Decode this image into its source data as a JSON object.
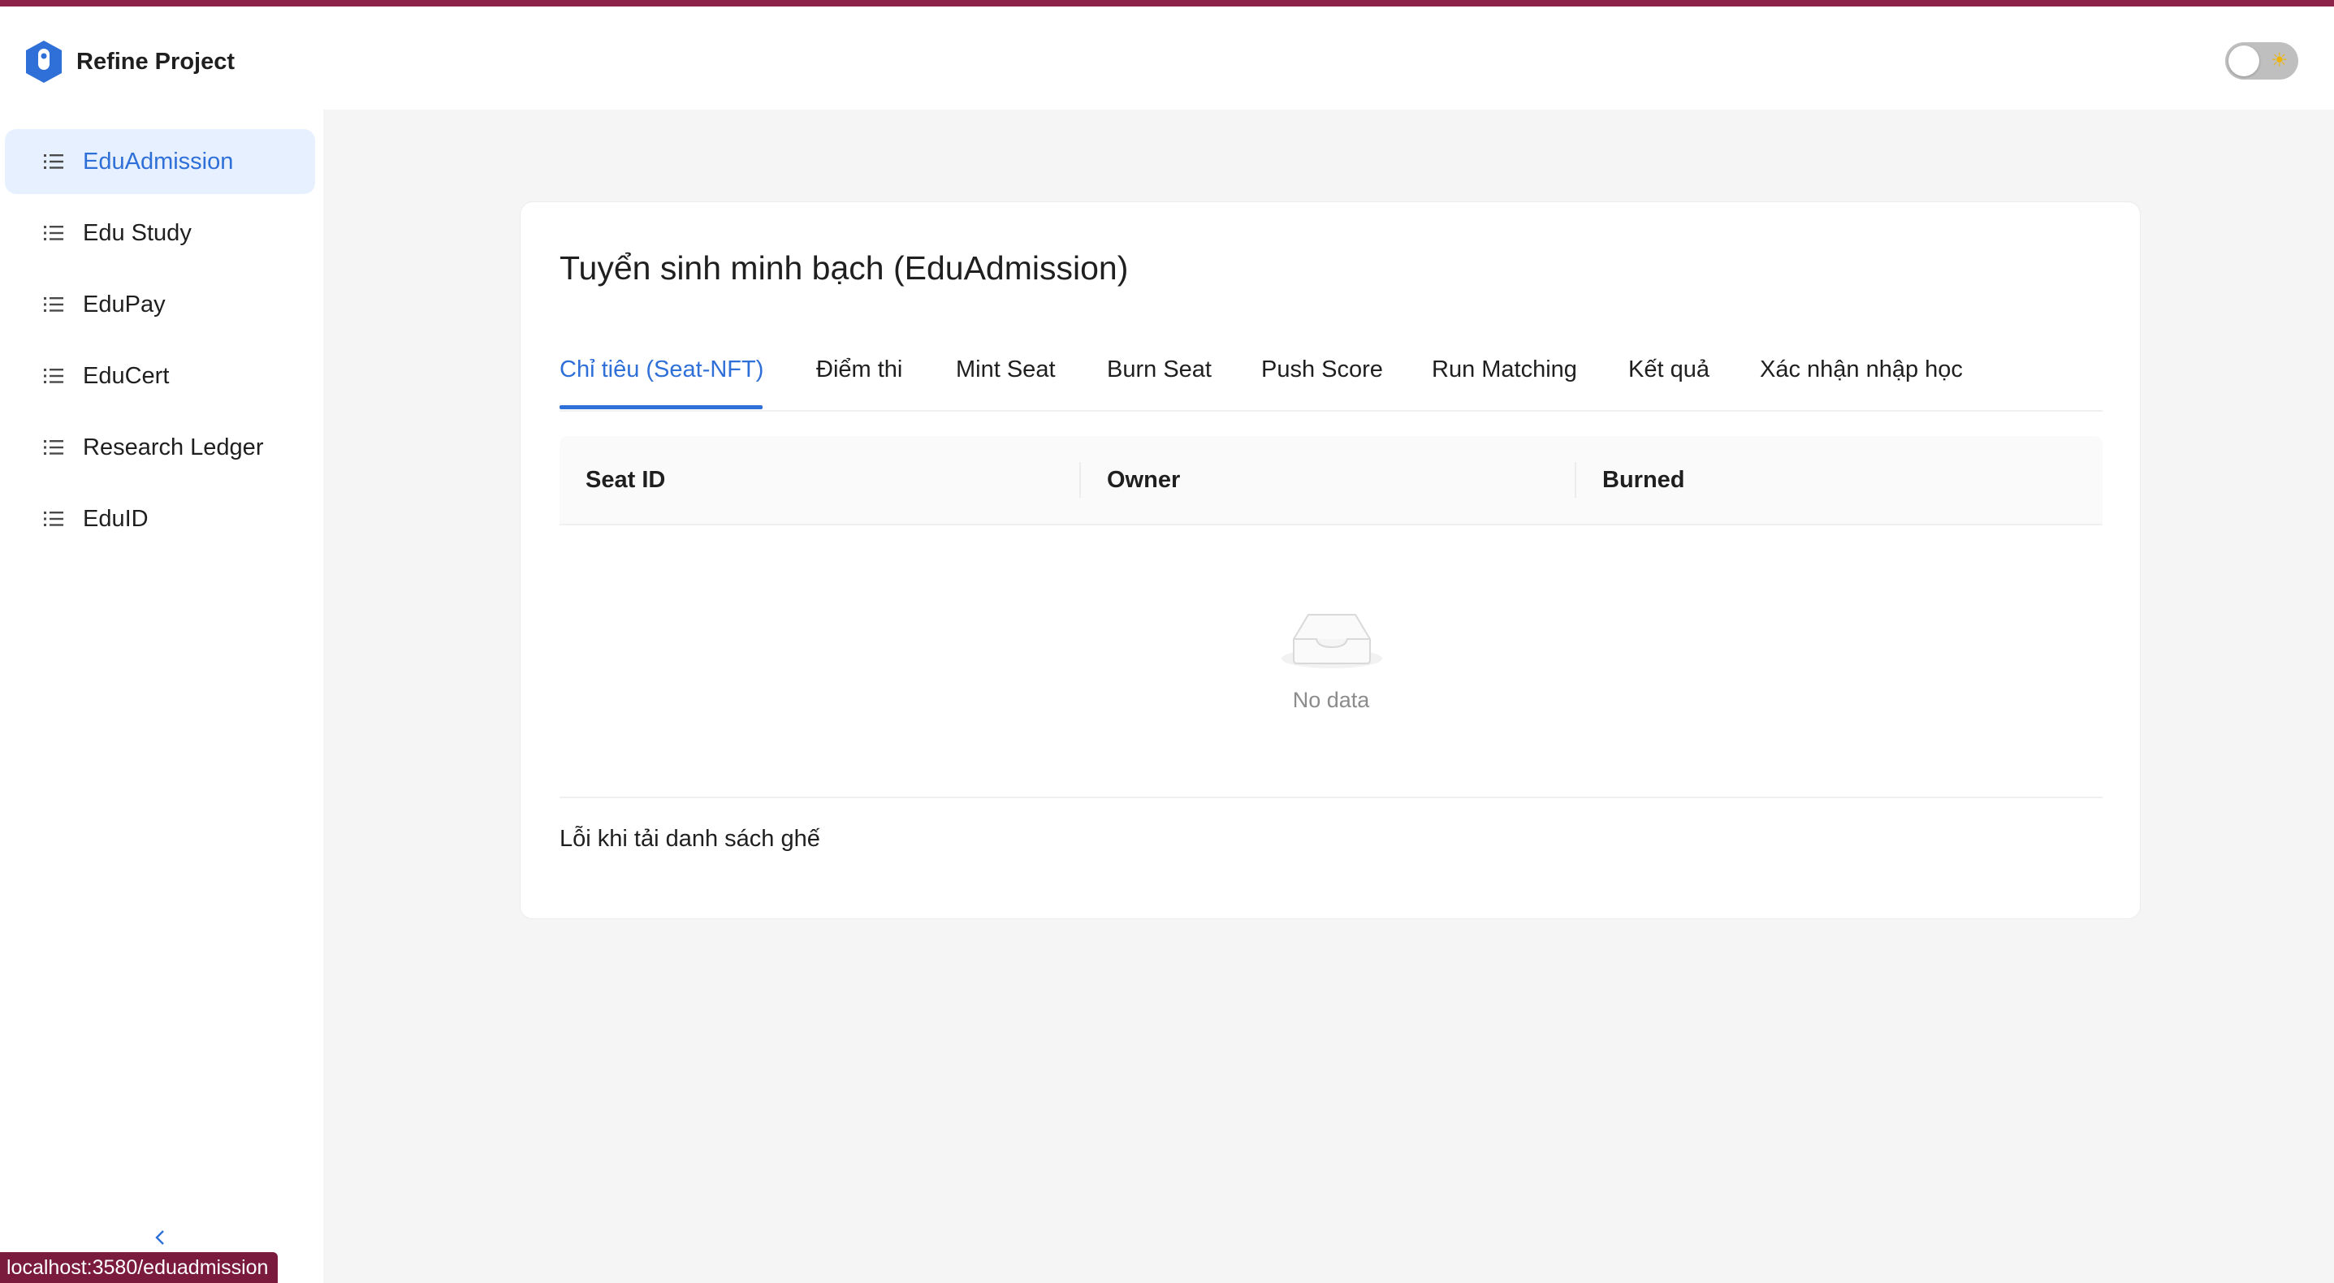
{
  "app": {
    "title": "Refine Project",
    "accent_color": "#8e2349",
    "primary_color": "#2f6fd8"
  },
  "header": {
    "theme_toggle": {
      "state": "off",
      "icon": "sun-icon"
    }
  },
  "sidebar": {
    "items": [
      {
        "label": "EduAdmission",
        "icon": "list-icon",
        "active": true
      },
      {
        "label": "Edu Study",
        "icon": "list-icon",
        "active": false
      },
      {
        "label": "EduPay",
        "icon": "list-icon",
        "active": false
      },
      {
        "label": "EduCert",
        "icon": "list-icon",
        "active": false
      },
      {
        "label": "Research Ledger",
        "icon": "list-icon",
        "active": false
      },
      {
        "label": "EduID",
        "icon": "list-icon",
        "active": false
      }
    ],
    "collapse_icon": "chevron-left-icon"
  },
  "main": {
    "title": "Tuyển sinh minh bạch (EduAdmission)",
    "tabs": [
      {
        "label": "Chỉ tiêu (Seat-NFT)",
        "active": true
      },
      {
        "label": "Điểm thi",
        "active": false
      },
      {
        "label": "Mint Seat",
        "active": false
      },
      {
        "label": "Burn Seat",
        "active": false
      },
      {
        "label": "Push Score",
        "active": false
      },
      {
        "label": "Run Matching",
        "active": false
      },
      {
        "label": "Kết quả",
        "active": false
      },
      {
        "label": "Xác nhận nhập học",
        "active": false
      }
    ],
    "table": {
      "columns": [
        "Seat ID",
        "Owner",
        "Burned"
      ],
      "rows": [],
      "empty_text": "No data"
    },
    "error_message": "Lỗi khi tải danh sách ghế"
  },
  "status_bar": {
    "url": "localhost:3580/eduadmission"
  }
}
